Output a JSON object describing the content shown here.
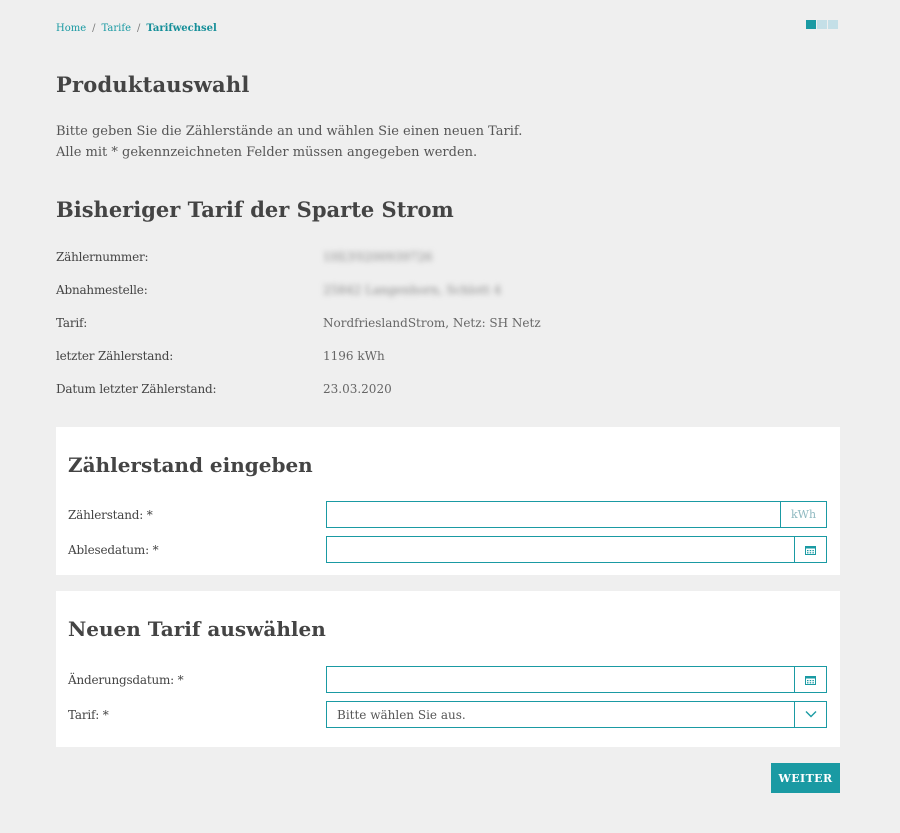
{
  "breadcrumb": {
    "items": [
      "Home",
      "Tarife"
    ],
    "current": "Tarifwechsel"
  },
  "steps": {
    "total": 3,
    "active": 1
  },
  "page": {
    "title": "Produktauswahl",
    "intro_line1": "Bitte geben Sie die Zählerstände an und wählen Sie einen neuen Tarif.",
    "intro_line2": "Alle mit * gekennzeichneten Felder müssen angegeben werden."
  },
  "current_tariff": {
    "title": "Bisheriger Tarif der Sparte Strom",
    "rows": [
      {
        "label": "Zählernummer:",
        "value": "1HLY0200939726",
        "blurred": true
      },
      {
        "label": "Abnahmestelle:",
        "value": "25842 Langenhorn, Schlott 4",
        "blurred": true
      },
      {
        "label": "Tarif:",
        "value": "NordfrieslandStrom, Netz: SH Netz",
        "blurred": false
      },
      {
        "label": "letzter Zählerstand:",
        "value": "1196 kWh",
        "blurred": false
      },
      {
        "label": "Datum letzter Zählerstand:",
        "value": "23.03.2020",
        "blurred": false
      }
    ]
  },
  "meter_card": {
    "title": "Zählerstand eingeben",
    "reading_label": "Zählerstand: *",
    "reading_value": "",
    "reading_unit": "kWh",
    "date_label": "Ablesedatum: *",
    "date_value": ""
  },
  "tariff_card": {
    "title": "Neuen Tarif auswählen",
    "change_date_label": "Änderungsdatum: *",
    "change_date_value": "",
    "tariff_label": "Tarif: *",
    "tariff_selected": "Bitte wählen Sie aus."
  },
  "actions": {
    "next_label": "WEITER"
  },
  "colors": {
    "accent": "#1a9aa3",
    "background": "#efefef",
    "card": "#ffffff"
  },
  "icons": {
    "calendar": "calendar-icon",
    "dropdown": "chevron-down-icon"
  }
}
